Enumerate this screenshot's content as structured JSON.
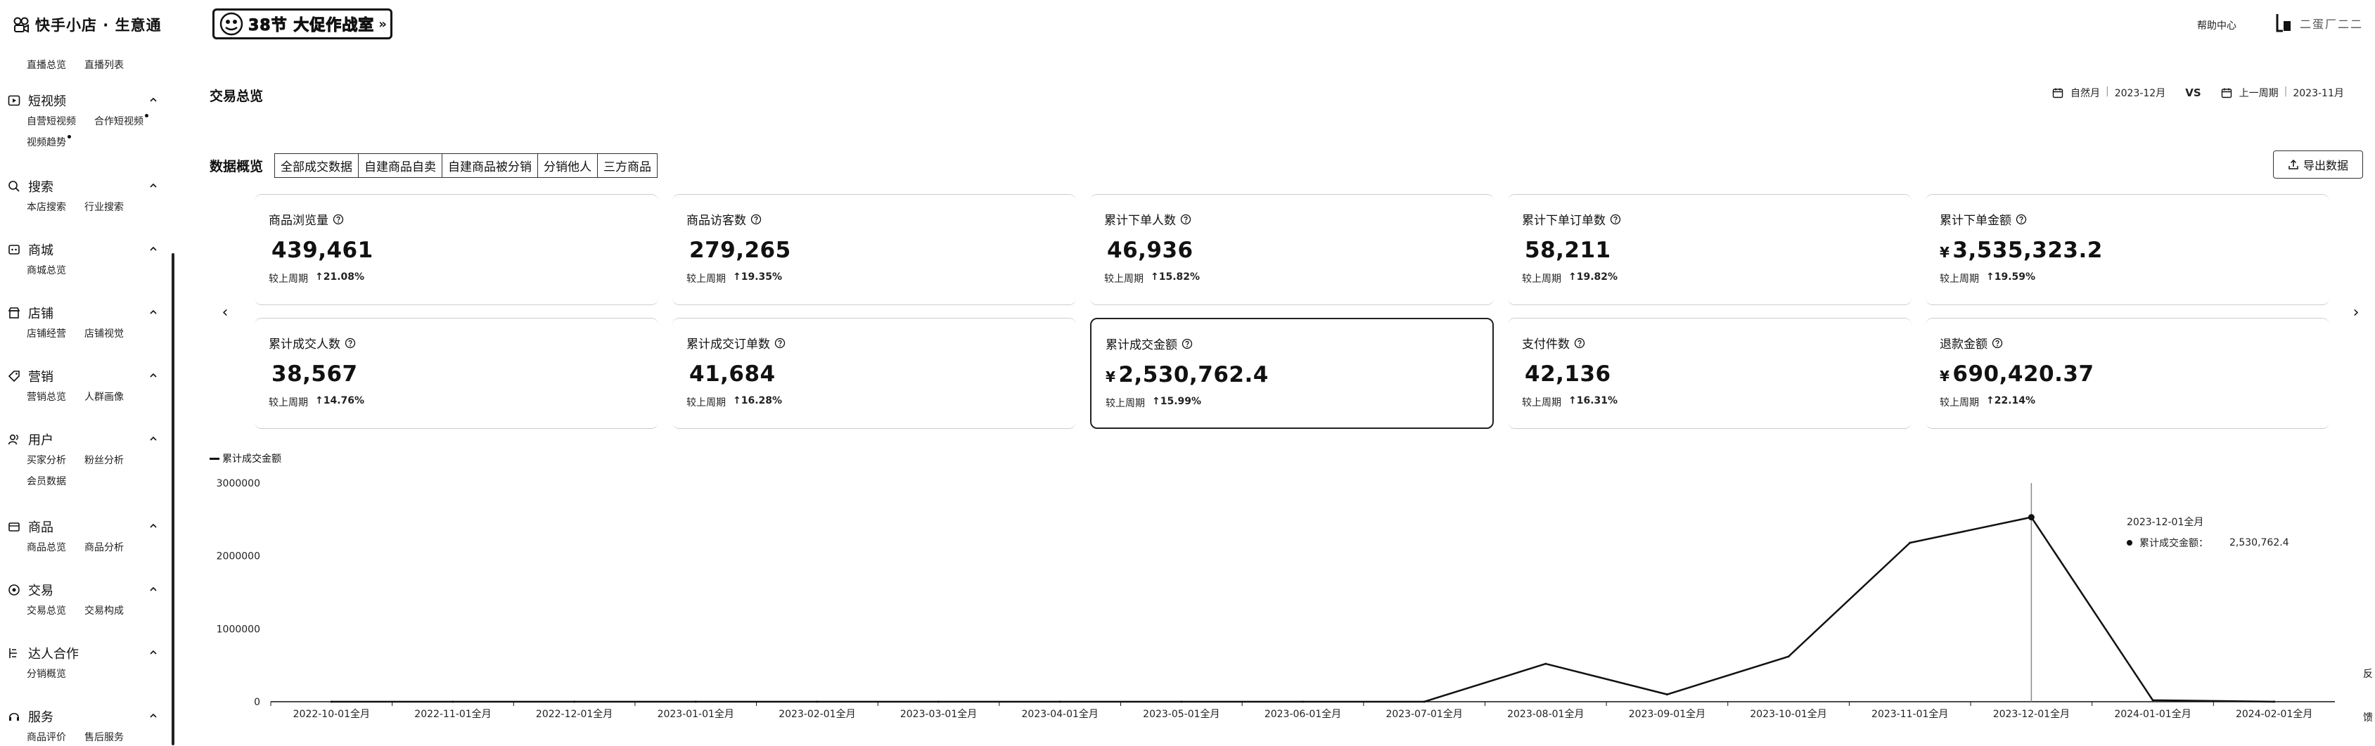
{
  "app": {
    "title": "快手小店 · 生意通"
  },
  "promo": {
    "label": "38节 大促作战室"
  },
  "header": {
    "help": "帮助中心",
    "user_name": "二蛋厂二二"
  },
  "sidebar": {
    "top_links": [
      "直播总览",
      "直播列表"
    ],
    "sections": [
      {
        "title": "短视频",
        "icon": "video-icon",
        "items": [
          "自营短视频",
          "合作短视频",
          "视频趋势"
        ]
      },
      {
        "title": "搜索",
        "icon": "search-icon",
        "items": [
          "本店搜索",
          "行业搜索"
        ]
      },
      {
        "title": "商城",
        "icon": "mall-icon",
        "items": [
          "商城总览"
        ]
      },
      {
        "title": "店铺",
        "icon": "store-icon",
        "items": [
          "店铺经营",
          "店铺视觉"
        ]
      },
      {
        "title": "营销",
        "icon": "tag-icon",
        "items": [
          "营销总览",
          "人群画像"
        ]
      },
      {
        "title": "用户",
        "icon": "users-icon",
        "items": [
          "买家分析",
          "粉丝分析",
          "会员数据"
        ]
      },
      {
        "title": "商品",
        "icon": "product-icon",
        "items": [
          "商品总览",
          "商品分析"
        ]
      },
      {
        "title": "交易",
        "icon": "trade-icon",
        "items": [
          "交易总览",
          "交易构成"
        ]
      },
      {
        "title": "达人合作",
        "icon": "creator-icon",
        "items": [
          "分销概览"
        ]
      },
      {
        "title": "服务",
        "icon": "service-icon",
        "items": [
          "商品评价",
          "售后服务"
        ]
      }
    ]
  },
  "page": {
    "title": "交易总览"
  },
  "compare": {
    "left_period_type": "自然月",
    "left_period": "2023-12月",
    "vs": "VS",
    "right_period_type": "上一周期",
    "right_period": "2023-11月"
  },
  "overview": {
    "label": "数据概览",
    "tabs": [
      "全部成交数据",
      "自建商品自卖",
      "自建商品被分销",
      "分销他人",
      "三方商品"
    ],
    "export_label": "导出数据"
  },
  "metrics": [
    {
      "title": "商品浏览量",
      "value": "439,461",
      "prefix": "",
      "compare": "较上周期",
      "delta": "21.08%"
    },
    {
      "title": "商品访客数",
      "value": "279,265",
      "prefix": "",
      "compare": "较上周期",
      "delta": "19.35%"
    },
    {
      "title": "累计下单人数",
      "value": "46,936",
      "prefix": "",
      "compare": "较上周期",
      "delta": "15.82%"
    },
    {
      "title": "累计下单订单数",
      "value": "58,211",
      "prefix": "",
      "compare": "较上周期",
      "delta": "19.82%"
    },
    {
      "title": "累计下单金额",
      "value": "3,535,323.2",
      "prefix": "¥",
      "compare": "较上周期",
      "delta": "19.59%"
    },
    {
      "title": "累计成交人数",
      "value": "38,567",
      "prefix": "",
      "compare": "较上周期",
      "delta": "14.76%"
    },
    {
      "title": "累计成交订单数",
      "value": "41,684",
      "prefix": "",
      "compare": "较上周期",
      "delta": "16.28%"
    },
    {
      "title": "累计成交金额",
      "value": "2,530,762.4",
      "prefix": "¥",
      "compare": "较上周期",
      "delta": "15.99%"
    },
    {
      "title": "支付件数",
      "value": "42,136",
      "prefix": "",
      "compare": "较上周期",
      "delta": "16.31%"
    },
    {
      "title": "退款金额",
      "value": "690,420.37",
      "prefix": "¥",
      "compare": "较上周期",
      "delta": "22.14%"
    }
  ],
  "chart_data": {
    "type": "line",
    "title": "",
    "xlabel": "",
    "ylabel": "",
    "legend": "累计成交金额",
    "legend_position": "top-left",
    "categories": [
      "2022-10-01全月",
      "2022-11-01全月",
      "2022-12-01全月",
      "2023-01-01全月",
      "2023-02-01全月",
      "2023-03-01全月",
      "2023-04-01全月",
      "2023-05-01全月",
      "2023-06-01全月",
      "2023-07-01全月",
      "2023-08-01全月",
      "2023-09-01全月",
      "2023-10-01全月",
      "2023-11-01全月",
      "2023-12-01全月",
      "2024-01-01全月",
      "2024-02-01全月"
    ],
    "series": [
      {
        "name": "累计成交金额",
        "values": [
          0,
          0,
          0,
          0,
          0,
          0,
          0,
          0,
          0,
          0,
          520000,
          100000,
          620000,
          2180000,
          2530762.4,
          20000,
          0
        ]
      }
    ],
    "ylim": [
      0,
      3000000
    ],
    "yticks": [
      "0",
      "1000000",
      "2000000",
      "3000000"
    ],
    "grid": false,
    "tooltip": {
      "date": "2023-12-01全月",
      "label": "累计成交金额：",
      "value": "2,530,762.4"
    }
  },
  "side_tab": {
    "label": "反馈"
  }
}
